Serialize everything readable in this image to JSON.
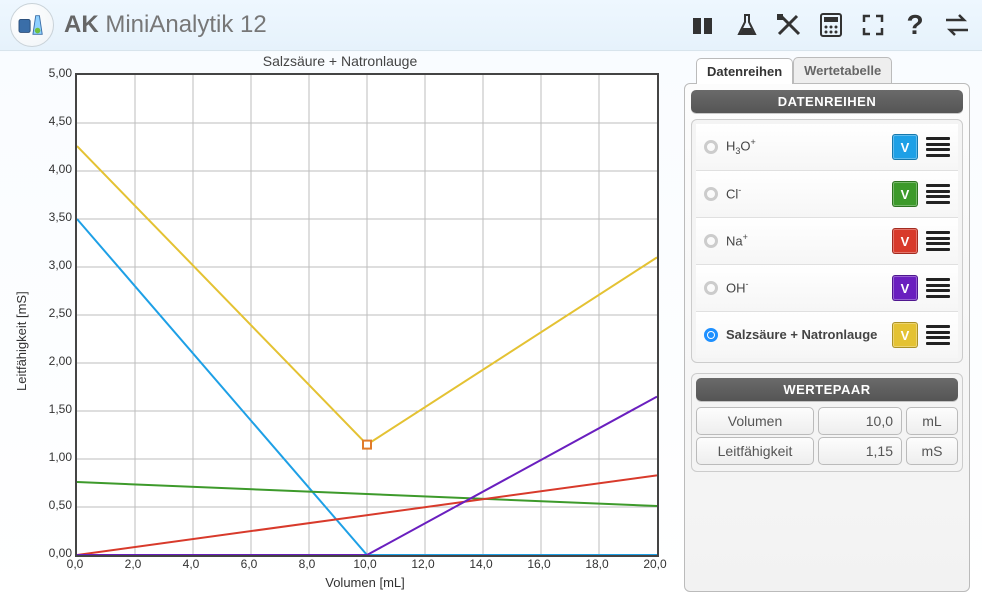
{
  "app": {
    "bold": "AK",
    "rest": "MiniAnalytik 12"
  },
  "toolbar_icons": [
    "beakers-icon",
    "flask-icon",
    "tools-icon",
    "calculator-icon",
    "fullscreen-icon",
    "help-icon",
    "swap-icon"
  ],
  "chart_title": "Salzsäure + Natronlauge",
  "xlabel": "Volumen [mL]",
  "ylabel": "Leitfähigkeit [mS]",
  "tabs": {
    "active": "Datenreihen",
    "inactive": "Wertetabelle"
  },
  "section_series": "DATENREIHEN",
  "section_pair": "WERTEPAAR",
  "series": [
    {
      "name_html": "H<sub>3</sub>O<sup>+</sup>",
      "color": "#1ea0e6",
      "selected": false,
      "varies_y": true
    },
    {
      "name_html": "Cl<sup>-</sup>",
      "color": "#3d9a2b",
      "selected": false,
      "varies_y": true
    },
    {
      "name_html": "Na<sup>+</sup>",
      "color": "#d83a2b",
      "selected": false,
      "varies_y": true
    },
    {
      "name_html": "OH<sup>-</sup>",
      "color": "#6a1fbf",
      "selected": false,
      "varies_y": true
    },
    {
      "name_html": "Salzsäure + Natronlauge",
      "color": "#e4c233",
      "selected": true,
      "varies_y": true
    }
  ],
  "pair": {
    "vol_label": "Volumen",
    "vol_value": "10,0",
    "vol_unit": "mL",
    "cond_label": "Leitfähigkeit",
    "cond_value": "1,15",
    "cond_unit": "mS"
  },
  "chart_data": {
    "type": "line",
    "xlabel": "Volumen [mL]",
    "ylabel": "Leitfähigkeit [mS]",
    "xlim": [
      0,
      20
    ],
    "ylim": [
      0,
      5.0
    ],
    "x_ticks": [
      0,
      2,
      4,
      6,
      8,
      10,
      12,
      14,
      16,
      18,
      20
    ],
    "y_ticks": [
      0.0,
      0.5,
      1.0,
      1.5,
      2.0,
      2.5,
      3.0,
      3.5,
      4.0,
      4.5,
      5.0
    ],
    "title": "Salzsäure + Natronlauge",
    "series": [
      {
        "name": "H3O+",
        "color": "#1ea0e6",
        "x": [
          0,
          10,
          20
        ],
        "y": [
          3.5,
          0.0,
          0.0
        ]
      },
      {
        "name": "Cl-",
        "color": "#3d9a2b",
        "x": [
          0,
          20
        ],
        "y": [
          0.76,
          0.51
        ]
      },
      {
        "name": "Na+",
        "color": "#d83a2b",
        "x": [
          0,
          20
        ],
        "y": [
          0.0,
          0.83
        ]
      },
      {
        "name": "OH-",
        "color": "#6a1fbf",
        "x": [
          0,
          10,
          20
        ],
        "y": [
          0.0,
          0.0,
          1.65
        ]
      },
      {
        "name": "Salzsäure + Natronlauge",
        "color": "#e4c233",
        "x": [
          0,
          10,
          20
        ],
        "y": [
          4.26,
          1.15,
          3.1
        ]
      }
    ],
    "marker": {
      "x": 10,
      "y": 1.15,
      "color": "#e07b2b"
    }
  }
}
